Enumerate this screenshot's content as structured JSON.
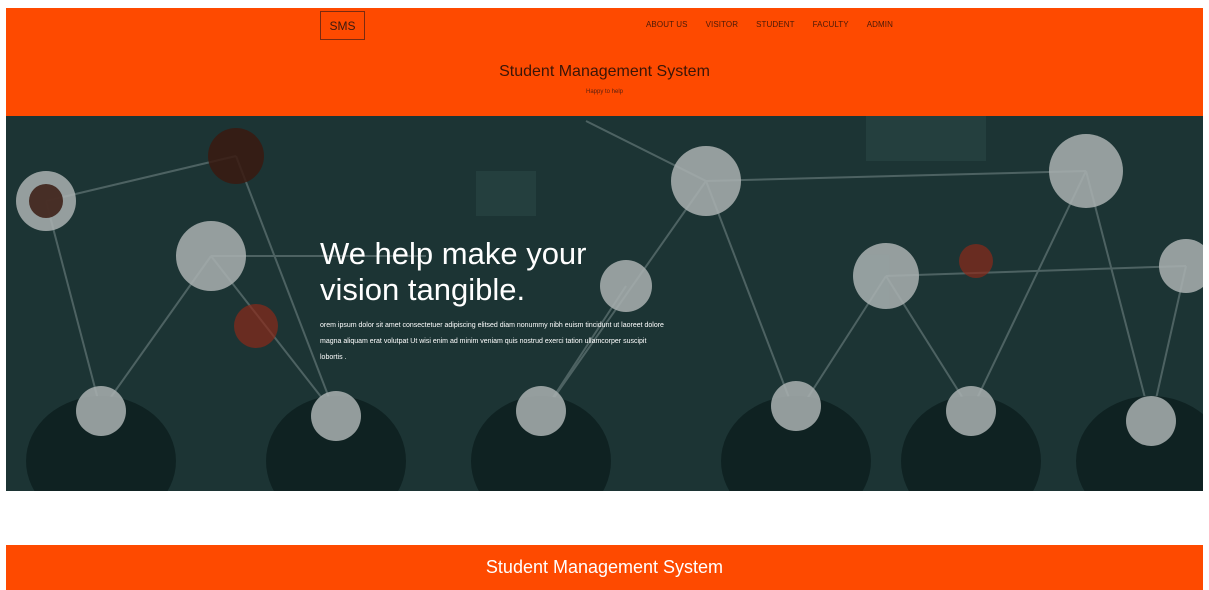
{
  "header": {
    "logo": "SMS",
    "nav": [
      "ABOUT US",
      "VISITOR",
      "STUDENT",
      "FACULTY",
      "ADMIN"
    ],
    "title": "Student Management System",
    "subtitle": "Happy to help"
  },
  "hero": {
    "title_line1": "We help make your",
    "title_line2": "vision tangible.",
    "body": "orem ipsum dolor sit amet consectetuer adipiscing elitsed diam nonummy nibh euism tincidunt ut laoreet dolore magna aliquam erat volutpat Ut wisi enim ad minim veniam quis nostrud exerci tation ullamcorper suscipit lobortis ."
  },
  "footer": {
    "title": "Student Management System"
  },
  "colors": {
    "brand": "#fe4a00",
    "hero_bg": "#1c3434"
  }
}
